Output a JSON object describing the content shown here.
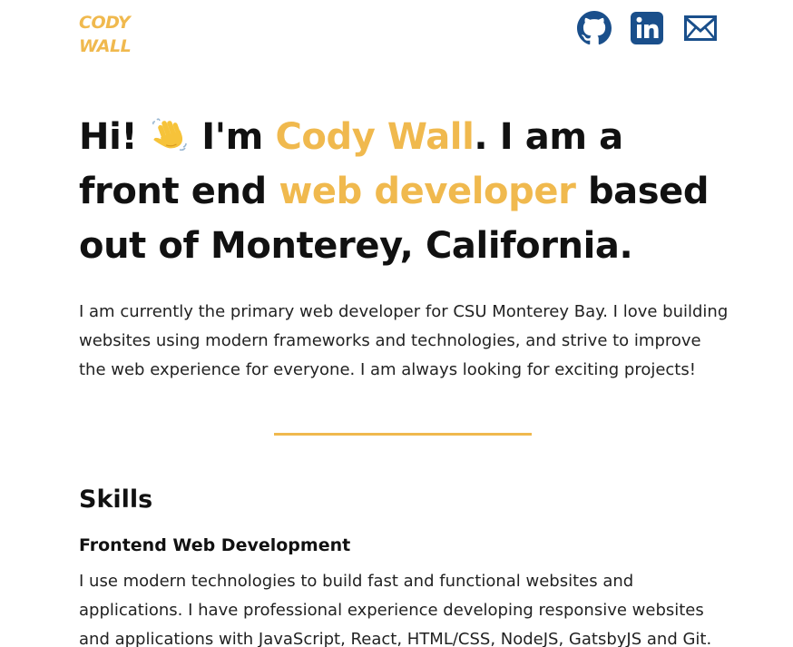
{
  "header": {
    "logo_line1": "CODY",
    "logo_line2": "WALL",
    "social_links": [
      {
        "name": "GitHub",
        "icon": "github-icon"
      },
      {
        "name": "LinkedIn",
        "icon": "linkedin-icon"
      },
      {
        "name": "Email",
        "icon": "mail-icon"
      }
    ]
  },
  "hero": {
    "greeting": "Hi!",
    "wave_icon": "waving-hand-icon",
    "im": "I'm",
    "name": "Cody Wall",
    "mid": ". I am a front end",
    "role": "web developer",
    "tail": "based out of Monterey, California."
  },
  "intro": {
    "text": "I am currently the primary web developer for CSU Monterey Bay. I love building websites using modern frameworks and technologies, and strive to improve the web experience for everyone. I am always looking for exciting projects!"
  },
  "skills": {
    "title": "Skills",
    "items": [
      {
        "heading": "Frontend Web Development",
        "description": "I use modern technologies to build fast and functional websites and applications. I have professional experience developing responsive websites and applications with JavaScript, React, HTML/CSS, NodeJS, GatsbyJS and Git."
      }
    ]
  },
  "colors": {
    "accent": "#f0b94e",
    "text": "#111111",
    "icon_blue": "#1a4f8b"
  }
}
